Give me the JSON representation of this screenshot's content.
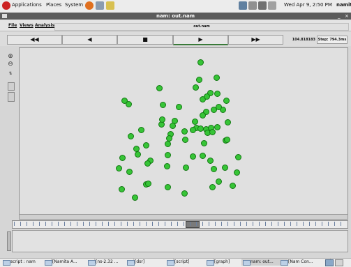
{
  "top_panel": {
    "applications": "Applications",
    "places": "Places",
    "system": "System",
    "clock": "Wed Apr 9, 2:50 PM",
    "user": "namit"
  },
  "window": {
    "title": "nam: out.nam"
  },
  "menubar": {
    "file": "File",
    "views": "Views",
    "analysis": "Analysis",
    "filename": "out.nam"
  },
  "transport": {
    "rewind": "◀◀",
    "back": "◀",
    "stop": "■",
    "play": "▶",
    "fast_forward": "▶▶",
    "time": "104.818183",
    "step": "Step: 794.3ms"
  },
  "nodes_count": 70,
  "taskbar": {
    "items": [
      {
        "label": "script : nam"
      },
      {
        "label": "[Namita A..."
      },
      {
        "label": "[ns-2.32 ..."
      },
      {
        "label": "[dsr]"
      },
      {
        "label": "[script]"
      },
      {
        "label": "[graph]"
      },
      {
        "label": "nam: out..."
      },
      {
        "label": "[Nam Con..."
      }
    ]
  }
}
